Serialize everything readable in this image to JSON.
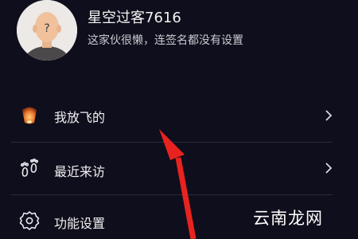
{
  "profile": {
    "nickname": "星空过客7616",
    "bio": "这家伙很懒，连签名都没有设置"
  },
  "menu": {
    "items": [
      {
        "label": "我放飞的",
        "icon": "sky-lantern-icon"
      },
      {
        "label": "最近来访",
        "icon": "footprint-icon"
      },
      {
        "label": "功能设置",
        "icon": "gear-icon"
      }
    ]
  },
  "watermark": {
    "text": "云南龙网"
  },
  "colors": {
    "background": "#0f0e1c",
    "divider": "#2c2b3b",
    "annotation_arrow": "#e8231f",
    "lantern": "#e8732a"
  }
}
